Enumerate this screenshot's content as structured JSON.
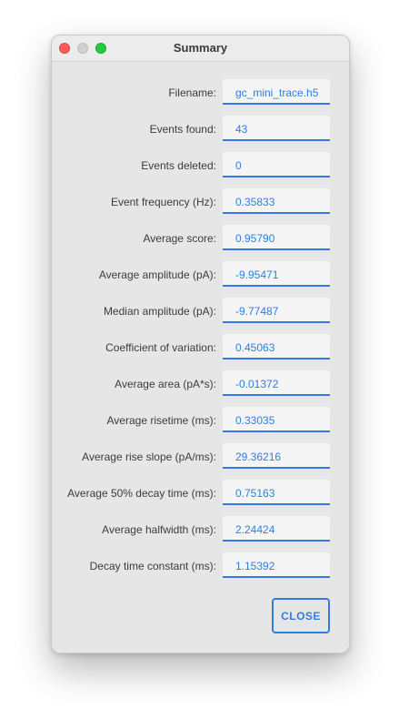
{
  "window": {
    "title": "Summary"
  },
  "fields": [
    {
      "label": "Filename:",
      "value": "gc_mini_trace.h5"
    },
    {
      "label": "Events found:",
      "value": "43"
    },
    {
      "label": "Events deleted:",
      "value": "0"
    },
    {
      "label": "Event frequency (Hz):",
      "value": "0.35833"
    },
    {
      "label": "Average score:",
      "value": "0.95790"
    },
    {
      "label": "Average amplitude (pA):",
      "value": "-9.95471"
    },
    {
      "label": "Median amplitude (pA):",
      "value": "-9.77487"
    },
    {
      "label": "Coefficient of variation:",
      "value": "0.45063"
    },
    {
      "label": "Average area (pA*s):",
      "value": "-0.01372"
    },
    {
      "label": "Average risetime (ms):",
      "value": "0.33035"
    },
    {
      "label": "Average rise slope (pA/ms):",
      "value": "29.36216"
    },
    {
      "label": "Average 50% decay time (ms):",
      "value": "0.75163"
    },
    {
      "label": "Average halfwidth (ms):",
      "value": "2.24424"
    },
    {
      "label": "Decay time constant (ms):",
      "value": "1.15392"
    }
  ],
  "buttons": {
    "close_label": "CLOSE"
  },
  "colors": {
    "accent": "#2f7de1",
    "field_bg": "#f5f5f6",
    "window_bg": "#e6e6e6"
  }
}
